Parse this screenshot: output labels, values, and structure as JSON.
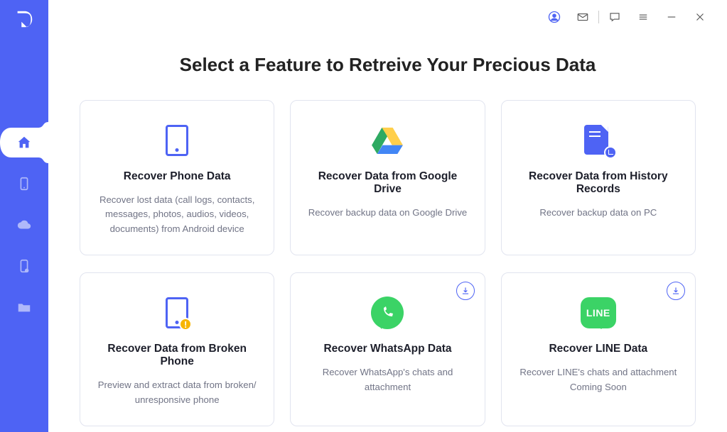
{
  "page_title": "Select a Feature to Retreive Your Precious Data",
  "colors": {
    "accent": "#4e63f4",
    "whatsapp": "#3bd366",
    "line": "#3bd366",
    "warning": "#f7b500"
  },
  "topbar": {
    "account": "account-icon",
    "mail": "mail-icon",
    "chat": "chat-icon",
    "menu": "menu-icon",
    "minimize": "minimize-icon",
    "close": "close-icon"
  },
  "sidebar": {
    "items": [
      {
        "name": "home",
        "active": true
      },
      {
        "name": "phone",
        "active": false
      },
      {
        "name": "cloud",
        "active": false
      },
      {
        "name": "broken-device",
        "active": false
      },
      {
        "name": "files",
        "active": false
      }
    ]
  },
  "cards": [
    {
      "icon": "phone-icon",
      "title": "Recover Phone Data",
      "desc": "Recover lost data (call logs, contacts, messages, photos, audios, videos, documents) from Android device",
      "download_badge": false,
      "extra": ""
    },
    {
      "icon": "google-drive-icon",
      "title": "Recover Data from Google Drive",
      "desc": "Recover backup data on Google Drive",
      "download_badge": false,
      "extra": ""
    },
    {
      "icon": "history-records-icon",
      "title": "Recover Data from History Records",
      "desc": "Recover backup data on PC",
      "download_badge": false,
      "extra": ""
    },
    {
      "icon": "broken-phone-icon",
      "title": "Recover Data from Broken Phone",
      "desc": "Preview and extract data from broken/ unresponsive phone",
      "download_badge": false,
      "extra": ""
    },
    {
      "icon": "whatsapp-icon",
      "title": "Recover WhatsApp Data",
      "desc": "Recover WhatsApp's chats and attachment",
      "download_badge": true,
      "extra": ""
    },
    {
      "icon": "line-icon",
      "title": "Recover LINE Data",
      "desc": "Recover LINE's chats and attachment",
      "download_badge": true,
      "extra": "Coming Soon"
    }
  ],
  "line_label": "LINE"
}
